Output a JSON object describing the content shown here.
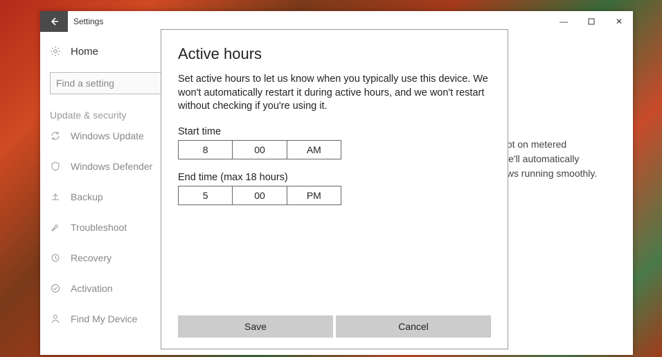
{
  "window": {
    "title": "Settings",
    "controls": {
      "min": "—",
      "max": "▢",
      "close": "✕"
    }
  },
  "sidebar": {
    "home": "Home",
    "search_placeholder": "Find a setting",
    "category": "Update & security",
    "items": [
      {
        "icon": "sync",
        "label": "Windows Update"
      },
      {
        "icon": "shield",
        "label": "Windows Defender"
      },
      {
        "icon": "backup",
        "label": "Backup"
      },
      {
        "icon": "wrench",
        "label": "Troubleshoot"
      },
      {
        "icon": "recovery",
        "label": "Recovery"
      },
      {
        "icon": "activation",
        "label": "Activation"
      },
      {
        "icon": "person",
        "label": "Find My Device"
      }
    ]
  },
  "bg_text": {
    "l1": "ept on metered",
    "l2": "we'll automatically",
    "l3": "ows running smoothly."
  },
  "dialog": {
    "title": "Active hours",
    "description": "Set active hours to let us know when you typically use this device. We won't automatically restart it during active hours, and we won't restart without checking if you're using it.",
    "start_label": "Start time",
    "start": {
      "h": "8",
      "m": "00",
      "ap": "AM"
    },
    "end_label": "End time (max 18 hours)",
    "end": {
      "h": "5",
      "m": "00",
      "ap": "PM"
    },
    "save": "Save",
    "cancel": "Cancel"
  }
}
